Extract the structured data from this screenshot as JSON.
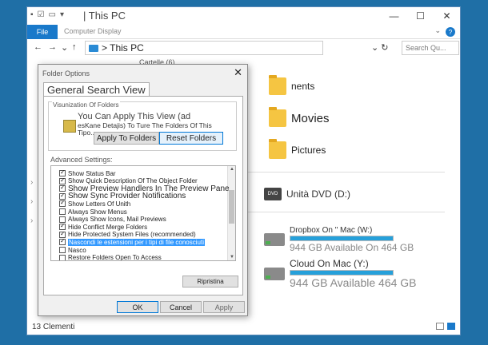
{
  "window": {
    "title": "| This PC",
    "controls": [
      "—",
      "☐",
      "✕"
    ],
    "qat": [
      "▪",
      "☑",
      "▭",
      "▾"
    ]
  },
  "ribbon": {
    "file_tab": "File",
    "tabs": "Computer Display",
    "collapse": "⌄",
    "help": "?"
  },
  "address": {
    "back": "←",
    "forward": "→",
    "dropdown": "⌄",
    "up": "↑",
    "path": "> This PC",
    "refresh": "⌄  ↻",
    "search_placeholder": "Search Qu..."
  },
  "content": {
    "partial_header": "Cartelle (6)",
    "folders": [
      {
        "label": "nents"
      },
      {
        "label": "Movies"
      },
      {
        "label": "Pictures"
      }
    ],
    "dvd": {
      "label": "Unità DVD (D:)",
      "icon_text": "DVD"
    },
    "drives": [
      {
        "name": "Dropbox On \" Mac (W:)",
        "space": "944 GB Available On 464 GB",
        "fill_pct": 100
      },
      {
        "name": "Cloud On Mac (Y:)",
        "space": "944 GB Available 464 GB",
        "fill_pct": 100
      }
    ],
    "nav_chevrons": [
      "›",
      "›",
      "›"
    ]
  },
  "status": {
    "items": "13 Clementi"
  },
  "dialog": {
    "title": "Folder Options",
    "close": "✕",
    "tabs": "General Search View",
    "folder_views_title": "Visunization Of Folders",
    "fv_line1": "You Can Apply This View (ad",
    "fv_line2": "esKane Detajis) To Ture The Folders Of This",
    "fv_line3": "Tipo...",
    "apply_to_folders": "Apply To Folders",
    "reset_folders": "Reset Folders",
    "advanced_title": "Advanced Settings:",
    "advanced_items": [
      {
        "label": "Show Status Bar",
        "checked": true,
        "big": false,
        "sel": false
      },
      {
        "label": "Show Quick Description Of The Object Folder",
        "checked": true,
        "big": false,
        "sel": false
      },
      {
        "label": "Show Preview Handlers In The Preview Pane",
        "checked": true,
        "big": true,
        "sel": false
      },
      {
        "label": "Show Sync Provider Notifications",
        "checked": true,
        "big": true,
        "sel": false
      },
      {
        "label": "Show Letters Of Unith",
        "checked": true,
        "big": false,
        "sel": false
      },
      {
        "label": "Always Show Menus",
        "checked": false,
        "big": false,
        "sel": false
      },
      {
        "label": "Always Show Icons, Mail Previews",
        "checked": false,
        "big": false,
        "sel": false
      },
      {
        "label": "Hide Conflict Merge Folders",
        "checked": true,
        "big": false,
        "sel": false
      },
      {
        "label": "Hide Protected System Files (recommended)",
        "checked": true,
        "big": false,
        "sel": false
      },
      {
        "label": "Nascondi le estensioni per i tipi di file conosciuti",
        "checked": true,
        "big": false,
        "sel": true
      },
      {
        "label": "Nasco",
        "checked": false,
        "big": false,
        "sel": false
      },
      {
        "label": "Restore Folders Open To Access",
        "checked": false,
        "big": false,
        "sel": false
      }
    ],
    "restore_defaults": "Ripristina",
    "ok": "OK",
    "cancel": "Cancel",
    "apply": "Apply"
  }
}
